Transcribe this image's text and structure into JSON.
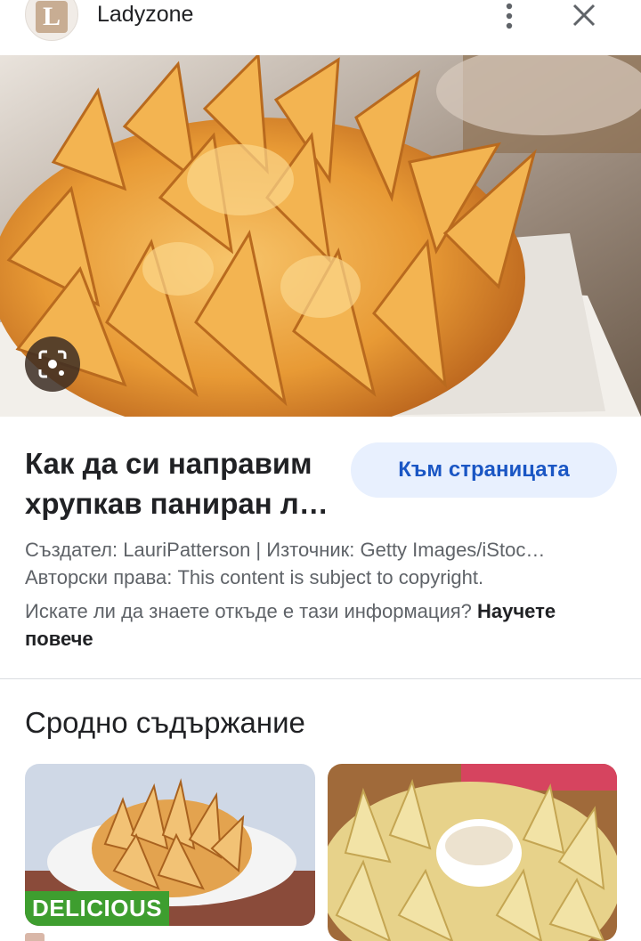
{
  "header": {
    "logo_letter": "L",
    "site_name": "Ladyzone",
    "more_icon": "more-vertical-icon",
    "close_icon": "close-icon"
  },
  "image": {
    "alt": "blooming onion",
    "lens_icon": "google-lens-icon"
  },
  "result": {
    "title_line1": "Как да си направим",
    "title_line2": "хрупкав паниран л…",
    "visit_button": "Към страницата",
    "creator": "Създател: LauriPatterson | Източник: Getty Images/iStoc…",
    "copyright": "Авторски права: This content is subject to copyright.",
    "info_question": "Искате ли да знаете откъде е тази информация?",
    "learn_more": "Научете повече"
  },
  "related": {
    "title": "Сродно съдържание",
    "cards": [
      {
        "badge": "DELICIOUS"
      },
      {
        "badge": ""
      }
    ]
  },
  "colors": {
    "accent": "#1a56c4",
    "button_bg": "#e8f0fe",
    "badge_green": "#3e9e2f"
  }
}
